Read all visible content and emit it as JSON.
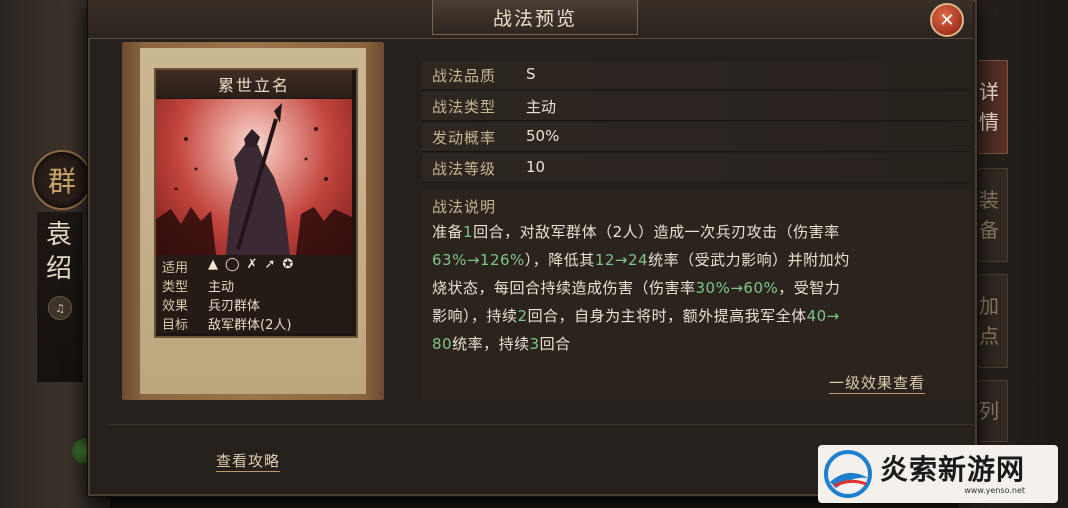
{
  "background": {
    "faction": "群",
    "general_name": "袁绍",
    "speaker_icon": "speaker-icon"
  },
  "side_tabs": [
    {
      "label": "详情",
      "active": true
    },
    {
      "label": "装备",
      "active": false
    },
    {
      "label": "加点",
      "active": false
    },
    {
      "label": "列",
      "active": false
    }
  ],
  "dialog": {
    "title": "战法预览",
    "close_icon": "close-icon"
  },
  "card": {
    "name": "累世立名",
    "stats": [
      {
        "key": "适用",
        "value": ""
      },
      {
        "key": "类型",
        "value": "主动"
      },
      {
        "key": "效果",
        "value": "兵刃群体"
      },
      {
        "key": "目标",
        "value": "敌军群体(2人)"
      }
    ],
    "troop_icons": [
      "cavalry-icon",
      "shield-icon",
      "bow-icon",
      "spear-icon",
      "siege-icon"
    ]
  },
  "info": [
    {
      "key": "战法品质",
      "value": "S"
    },
    {
      "key": "战法类型",
      "value": "主动"
    },
    {
      "key": "发动概率",
      "value": "50%"
    },
    {
      "key": "战法等级",
      "value": "10"
    }
  ],
  "description": {
    "title": "战法说明",
    "lines": [
      [
        {
          "t": "准备"
        },
        {
          "t": "1",
          "g": true
        },
        {
          "t": "回合，对敌军群体（2人）造成一次兵刃攻击（伤害率"
        }
      ],
      [
        {
          "t": "63%→126%",
          "g": true
        },
        {
          "t": "），降低其"
        },
        {
          "t": "12→24",
          "g": true
        },
        {
          "t": "统率（受武力影响）并附加灼"
        }
      ],
      [
        {
          "t": "烧状态，每回合持续造成伤害（伤害率"
        },
        {
          "t": "30%→60%",
          "g": true
        },
        {
          "t": "，受智力"
        }
      ],
      [
        {
          "t": "影响），持续"
        },
        {
          "t": "2",
          "g": true
        },
        {
          "t": "回合，自身为主将时，额外提高我军全体"
        },
        {
          "t": "40→",
          "g": true
        }
      ],
      [
        {
          "t": "80",
          "g": true
        },
        {
          "t": "统率，持续"
        },
        {
          "t": "3",
          "g": true
        },
        {
          "t": "回合"
        }
      ]
    ]
  },
  "links": {
    "level_effect": "一级效果查看",
    "guide": "查看攻略"
  },
  "watermark": {
    "name": "炎索新游网",
    "url": "www.yenso.net"
  },
  "colors": {
    "highlight": "#7fc58a",
    "label": "#c9b694",
    "close": "#c4402a"
  }
}
